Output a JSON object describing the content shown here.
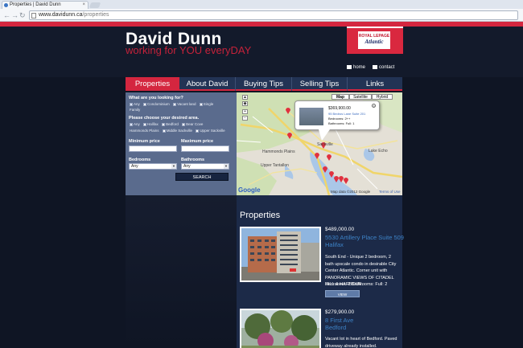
{
  "browser": {
    "tab_title": "Properties | David Dunn",
    "tab_close": "×",
    "back_glyph": "←",
    "forward_glyph": "→",
    "reload_glyph": "↻",
    "url_host": "www.davidunn.ca",
    "url_path": "/properties"
  },
  "header": {
    "title": "David Dunn",
    "tagline": "working for YOU everyDAY",
    "logo_line1": "ROYAL LEPAGE",
    "logo_line2": "Atlantic",
    "home_link": "home",
    "contact_link": "contact"
  },
  "nav": {
    "items": [
      {
        "label": "Properties",
        "active": true
      },
      {
        "label": "About David",
        "active": false
      },
      {
        "label": "Buying Tips",
        "active": false
      },
      {
        "label": "Selling Tips",
        "active": false
      },
      {
        "label": "Links",
        "active": false
      }
    ]
  },
  "search": {
    "looking_for_label": "What are you looking for?",
    "types": [
      "Any",
      "Condominium",
      "Vacant land",
      "Single",
      "Family"
    ],
    "area_label": "Please choose your desired area.",
    "areas_row1": [
      "Any",
      "Halifax",
      "Bedford",
      "Bear Cove"
    ],
    "areas_row2": [
      "Hammonds Plains",
      "Middle Sackville",
      "Upper Sackville"
    ],
    "min_price_label": "Minimum price",
    "max_price_label": "Maximum price",
    "bedrooms_label": "Bedrooms",
    "bathrooms_label": "Bathrooms",
    "bedrooms_value": "Any",
    "bathrooms_value": "Any",
    "button": "SEARCH"
  },
  "map": {
    "types": [
      "Map",
      "Satellite",
      "Hybrid"
    ],
    "selected_type": "Map",
    "bubble_price": "$369,900.00",
    "bubble_address": "95 Bedros Lane Suite 201",
    "bubble_bedrooms": "Bedrooms: 2++",
    "bubble_bathrooms": "Bathrooms: Full: 1",
    "places": [
      "Hammonds Plains",
      "Sackville",
      "Lake Echo",
      "Upper Tantallon"
    ],
    "google": "Google",
    "map_data": "Map data ©2012 Google",
    "terms": "Terms of Use"
  },
  "properties": {
    "heading": "Properties",
    "listings": [
      {
        "price": "$489,000.00",
        "address1": "5530 Artillery Place Suite 509",
        "address2": "Halifax",
        "desc": "South End - Unique 2 bedroom, 2 bath upscale condo in desirable City Center Atlantic. Corner unit with PANORAMIC VIEWS OF CITADEL HILL & HARBOUR.",
        "meta": "Bedrooms: 2 Bathrooms: Full: 2",
        "button": "VIEW"
      },
      {
        "price": "$279,900.00",
        "address1": "8 First Ave",
        "address2": "Bedford",
        "desc": "Vacant lot in heart of Bedford. Paved driveway already installed."
      }
    ]
  },
  "colors": {
    "accent": "#d4263f",
    "nav_bg": "#223354",
    "link": "#3d82c6"
  }
}
